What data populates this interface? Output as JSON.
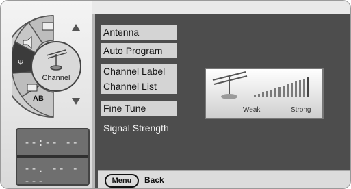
{
  "menu": {
    "items": [
      {
        "label": "Antenna"
      },
      {
        "label": "Auto Program"
      },
      {
        "label": "Channel Label"
      },
      {
        "label": "Channel List"
      },
      {
        "label": "Fine Tune"
      },
      {
        "label": "Signal Strength"
      }
    ],
    "selected": "Signal Strength"
  },
  "dial": {
    "center_label": "Channel",
    "ab_label": "AB",
    "icons": [
      "picture-icon",
      "sound-icon",
      "antenna-icon",
      "channel-icon",
      "setup-icon",
      "input-icon"
    ]
  },
  "signal": {
    "weak_label": "Weak",
    "strong_label": "Strong"
  },
  "time": {
    "line1": "--:-- --",
    "line2": "--. -- ----"
  },
  "footer": {
    "menu_button": "Menu",
    "back_label": "Back"
  }
}
